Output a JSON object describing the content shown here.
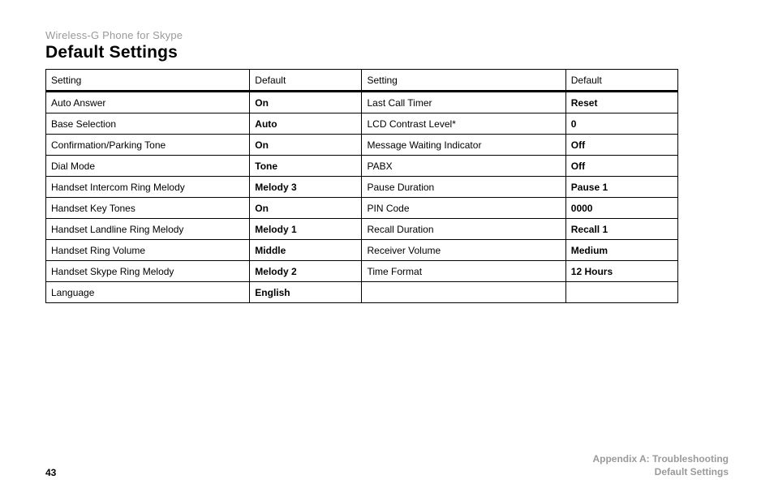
{
  "header": {
    "product_line": "Wireless-G Phone for Skype",
    "page_title": "Default Settings"
  },
  "table": {
    "columns": {
      "setting_left": "Setting",
      "default_left": "Default",
      "setting_right": "Setting",
      "default_right": "Default"
    },
    "rows": [
      {
        "ls": "Auto Answer",
        "ld": "On",
        "rs": "Last Call Timer",
        "rd": "Reset"
      },
      {
        "ls": "Base Selection",
        "ld": "Auto",
        "rs": "LCD Contrast Level*",
        "rd": "0"
      },
      {
        "ls": "Confirmation/Parking Tone",
        "ld": "On",
        "rs": "Message Waiting Indicator",
        "rd": "Off"
      },
      {
        "ls": "Dial Mode",
        "ld": "Tone",
        "rs": "PABX",
        "rd": "Off"
      },
      {
        "ls": "Handset Intercom Ring Melody",
        "ld": "Melody 3",
        "rs": "Pause Duration",
        "rd": "Pause 1"
      },
      {
        "ls": "Handset Key Tones",
        "ld": "On",
        "rs": "PIN Code",
        "rd": "0000"
      },
      {
        "ls": "Handset Landline Ring Melody",
        "ld": "Melody 1",
        "rs": "Recall Duration",
        "rd": "Recall 1"
      },
      {
        "ls": "Handset Ring Volume",
        "ld": "Middle",
        "rs": "Receiver Volume",
        "rd": "Medium"
      },
      {
        "ls": "Handset Skype Ring Melody",
        "ld": "Melody 2",
        "rs": "Time Format",
        "rd": "12 Hours"
      },
      {
        "ls": "Language",
        "ld": "English",
        "rs": "",
        "rd": ""
      }
    ]
  },
  "footer": {
    "page_number": "43",
    "appendix_line1": "Appendix A: Troubleshooting",
    "appendix_line2": "Default Settings"
  }
}
